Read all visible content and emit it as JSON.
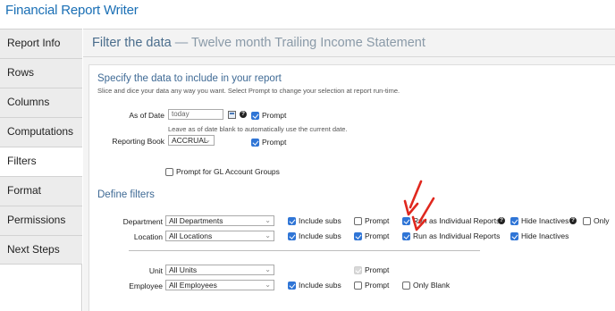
{
  "app_title": "Financial Report Writer",
  "sidebar": {
    "items": [
      {
        "label": "Report Info"
      },
      {
        "label": "Rows"
      },
      {
        "label": "Columns"
      },
      {
        "label": "Computations"
      },
      {
        "label": "Filters"
      },
      {
        "label": "Format"
      },
      {
        "label": "Permissions"
      },
      {
        "label": "Next Steps"
      }
    ],
    "active": "Filters"
  },
  "header": {
    "title": "Filter the data",
    "separator": " — ",
    "subtitle": "Twelve month Trailing Income Statement"
  },
  "specify": {
    "title": "Specify the data to include in your report",
    "hint": "Slice and dice your data any way you want. Select Prompt to change your selection at report run-time.",
    "as_of_date": {
      "label": "As of Date",
      "value": "today",
      "prompt_label": "Prompt",
      "prompt_checked": true,
      "help": "?"
    },
    "as_of_hint": "Leave as of date blank to automatically use the current date.",
    "reporting_book": {
      "label": "Reporting Book",
      "value": "ACCRUAL",
      "prompt_label": "Prompt",
      "prompt_checked": true
    },
    "gl_groups": {
      "label": "Prompt for GL Account Groups",
      "checked": false
    }
  },
  "filters": {
    "title": "Define filters",
    "department": {
      "label": "Department",
      "value": "All Departments",
      "include_subs": "Include subs",
      "prompt": "Prompt",
      "run_individual": "Run as Individual Reports",
      "hide_inactives": "Hide Inactives",
      "only": "Only",
      "help": "?"
    },
    "location": {
      "label": "Location",
      "value": "All Locations",
      "include_subs": "Include subs",
      "prompt": "Prompt",
      "run_individual": "Run as Individual Reports",
      "hide_inactives": "Hide Inactives"
    },
    "unit": {
      "label": "Unit",
      "value": "All Units",
      "prompt": "Prompt"
    },
    "employee": {
      "label": "Employee",
      "value": "All Employees",
      "include_subs": "Include subs",
      "prompt": "Prompt",
      "only_blank": "Only Blank"
    }
  },
  "colors": {
    "accent": "#1a6fb5",
    "checkbox": "#2f75d6",
    "arrow": "#e0281e",
    "section_title": "#3f6a95"
  }
}
